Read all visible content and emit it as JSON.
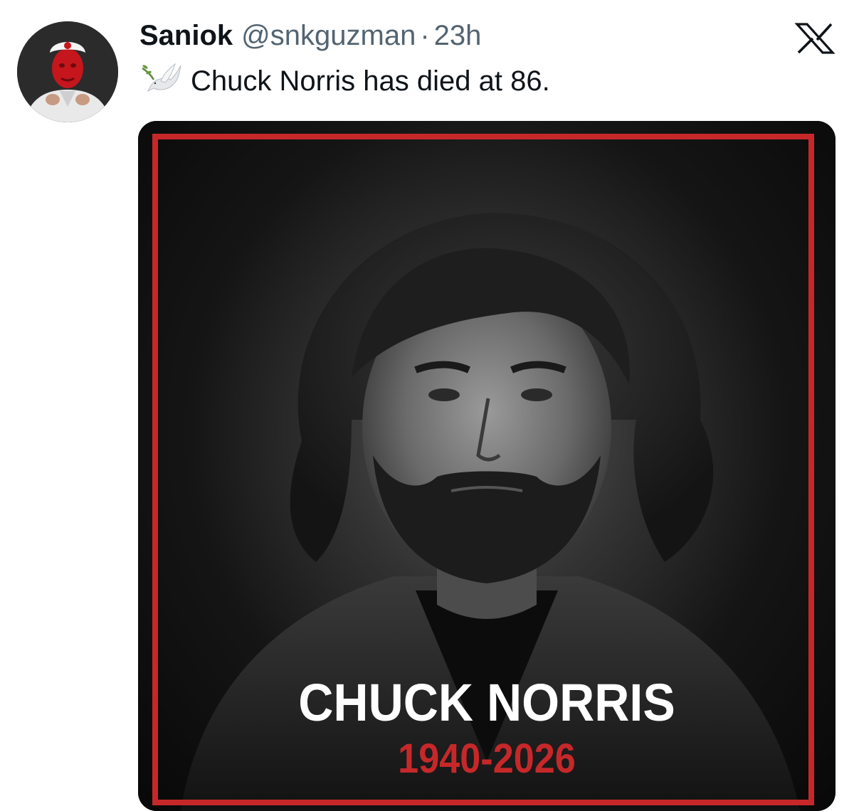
{
  "tweet": {
    "display_name": "Saniok",
    "handle": "@snkguzman",
    "separator": "·",
    "time": "23h",
    "text": "Chuck Norris has died at 86.",
    "emoji": "dove-with-olive-branch"
  },
  "app": {
    "logo_icon": "x-logo-icon"
  },
  "media": {
    "caption_name": "CHUCK NORRIS",
    "caption_years": "1940-2026",
    "frame_color": "#c6282a",
    "style": "black-and-white memorial portrait of a bearded man with shoulder-length hair in a dark coat"
  },
  "colors": {
    "text_primary": "#0f1419",
    "text_secondary": "#536471",
    "accent_red": "#c6282a"
  }
}
